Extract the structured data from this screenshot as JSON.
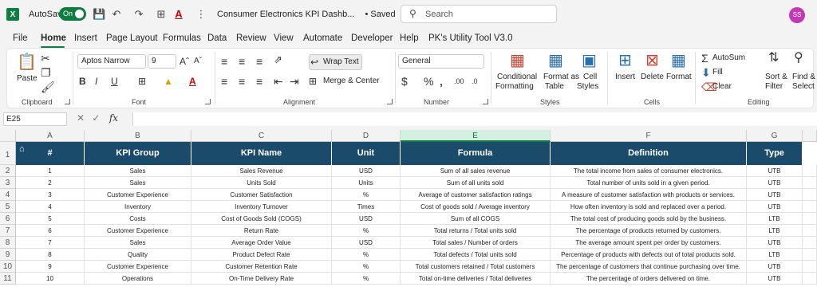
{
  "titlebar": {
    "app_icon": "X",
    "autosave_label": "AutoSave",
    "autosave_state": "On",
    "file_title": "Consumer Electronics KPI Dashb...",
    "saved_status": "• Saved",
    "search_placeholder": "Search",
    "user_initials": "SS"
  },
  "menu": {
    "items": [
      "File",
      "Home",
      "Insert",
      "Page Layout",
      "Formulas",
      "Data",
      "Review",
      "View",
      "Automate",
      "Developer",
      "Help",
      "PK's Utility Tool V3.0"
    ],
    "active": "Home"
  },
  "ribbon": {
    "clipboard": {
      "paste": "Paste",
      "group": "Clipboard"
    },
    "font": {
      "family": "Aptos Narrow",
      "size": "9",
      "group": "Font"
    },
    "alignment": {
      "wrap_text": "Wrap Text",
      "merge_center": "Merge & Center",
      "group": "Alignment"
    },
    "number": {
      "format": "General",
      "group": "Number"
    },
    "styles": {
      "conditional": "Conditional",
      "formatting": "Formatting",
      "format_as": "Format as",
      "table": "Table",
      "cell": "Cell",
      "styles": "Styles",
      "group": "Styles"
    },
    "cells": {
      "insert": "Insert",
      "delete": "Delete",
      "format": "Format",
      "group": "Cells"
    },
    "editing": {
      "autosum": "AutoSum",
      "fill": "Fill",
      "clear": "Clear",
      "sort": "Sort &",
      "filter": "Filter",
      "find": "Find &",
      "select": "Select",
      "group": "Editing"
    }
  },
  "formula_bar": {
    "name_box": "E25",
    "fx": "fx",
    "value": ""
  },
  "columns": [
    "A",
    "B",
    "C",
    "D",
    "E",
    "F",
    "G"
  ],
  "selected_column": "E",
  "row_numbers": [
    "1",
    "2",
    "3",
    "4",
    "5",
    "6",
    "7",
    "8",
    "9",
    "10",
    "11"
  ],
  "table": {
    "headers": [
      "#",
      "KPI Group",
      "KPI Name",
      "Unit",
      "Formula",
      "Definition",
      "Type"
    ],
    "rows": [
      [
        "1",
        "Sales",
        "Sales Revenue",
        "USD",
        "Sum of all sales revenue",
        "The total income from sales of consumer electronics.",
        "UTB"
      ],
      [
        "2",
        "Sales",
        "Units Sold",
        "Units",
        "Sum of all units sold",
        "Total number of units sold in a given period.",
        "UTB"
      ],
      [
        "3",
        "Customer Experience",
        "Customer Satisfaction",
        "%",
        "Average of customer satisfaction ratings",
        "A measure of customer satisfaction with products or services.",
        "UTB"
      ],
      [
        "4",
        "Inventory",
        "Inventory Turnover",
        "Times",
        "Cost of goods sold / Average inventory",
        "How often inventory is sold and replaced over a period.",
        "UTB"
      ],
      [
        "5",
        "Costs",
        "Cost of Goods Sold (COGS)",
        "USD",
        "Sum of all COGS",
        "The total cost of producing goods sold by the business.",
        "LTB"
      ],
      [
        "6",
        "Customer Experience",
        "Return Rate",
        "%",
        "Total returns / Total units sold",
        "The percentage of products returned by customers.",
        "LTB"
      ],
      [
        "7",
        "Sales",
        "Average Order Value",
        "USD",
        "Total sales / Number of orders",
        "The average amount spent per order by customers.",
        "UTB"
      ],
      [
        "8",
        "Quality",
        "Product Defect Rate",
        "%",
        "Total defects / Total units sold",
        "Percentage of products with defects out of total products sold.",
        "LTB"
      ],
      [
        "9",
        "Customer Experience",
        "Customer Retention Rate",
        "%",
        "Total customers retained / Total customers",
        "The percentage of customers that continue purchasing over time.",
        "UTB"
      ],
      [
        "10",
        "Operations",
        "On-Time Delivery Rate",
        "%",
        "Total on-time deliveries / Total deliveries",
        "The percentage of orders delivered on time.",
        "UTB"
      ]
    ]
  },
  "colors": {
    "accent": "#107c41",
    "header_fill": "#1b4b6b"
  }
}
